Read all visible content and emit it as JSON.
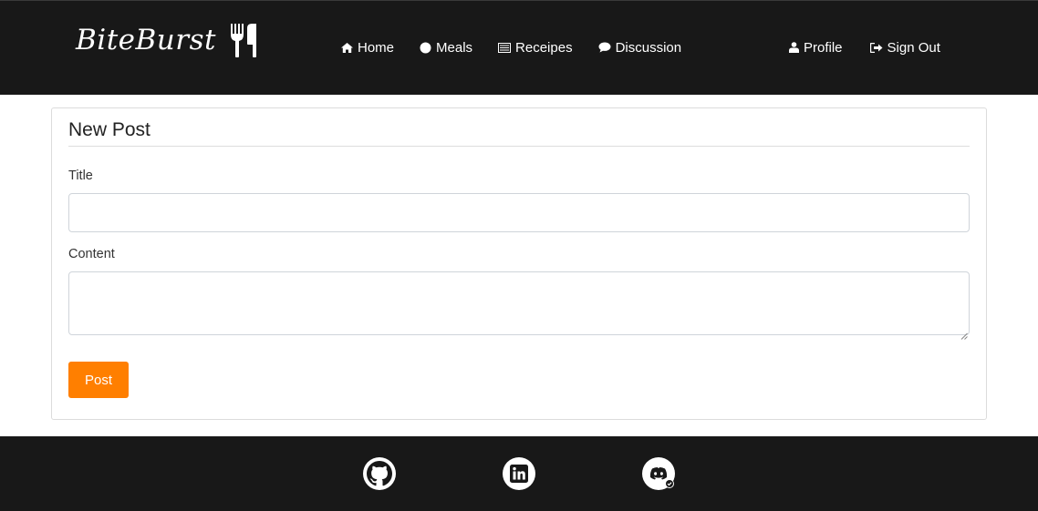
{
  "header": {
    "brand": "BiteBurst",
    "brand_icon": "utensils-icon",
    "nav_left": [
      {
        "label": "Home",
        "icon": "home-icon"
      },
      {
        "label": "Meals",
        "icon": "circle-icon"
      },
      {
        "label": "Receipes",
        "icon": "list-icon"
      },
      {
        "label": "Discussion",
        "icon": "comment-icon"
      }
    ],
    "nav_right": [
      {
        "label": "Profile",
        "icon": "user-icon"
      },
      {
        "label": "Sign Out",
        "icon": "sign-out-icon"
      }
    ]
  },
  "form": {
    "title": "New Post",
    "title_label": "Title",
    "title_value": "",
    "content_label": "Content",
    "content_value": "",
    "submit_label": "Post"
  },
  "footer": {
    "links": [
      {
        "icon": "github-icon"
      },
      {
        "icon": "linkedin-icon"
      },
      {
        "icon": "discord-icon"
      }
    ]
  },
  "colors": {
    "header_bg": "#181818",
    "accent": "#ff7f00",
    "text_light": "#ffffff"
  }
}
